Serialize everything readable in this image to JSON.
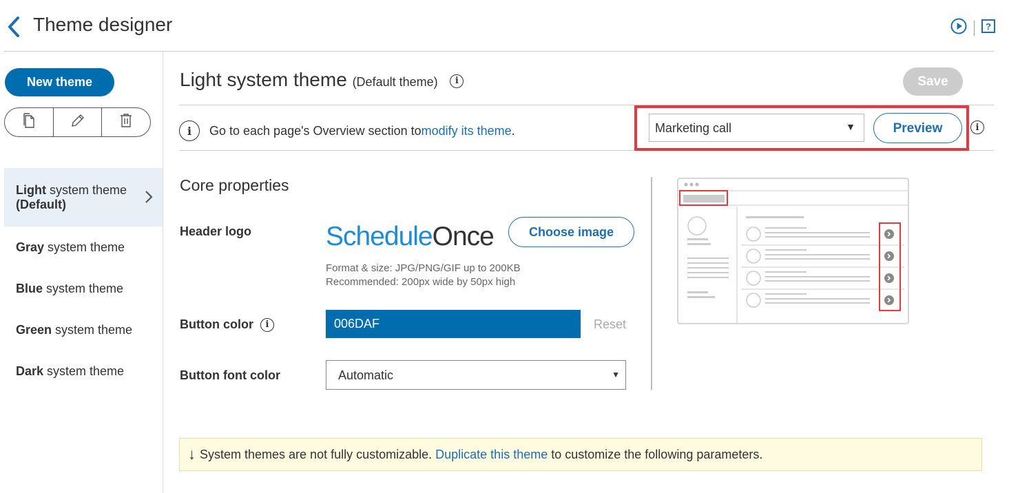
{
  "header": {
    "title": "Theme designer"
  },
  "sidebar": {
    "new_theme_label": "New theme",
    "themes": [
      {
        "bold": "Light",
        "rest": " system theme",
        "line2": "(Default)"
      },
      {
        "bold": "Gray",
        "rest": " system theme"
      },
      {
        "bold": "Blue",
        "rest": " system theme"
      },
      {
        "bold": "Green",
        "rest": " system theme"
      },
      {
        "bold": "Dark",
        "rest": " system theme"
      }
    ]
  },
  "main": {
    "title": "Light system theme",
    "subtitle": "(Default theme)",
    "save_label": "Save",
    "banner": {
      "text_before": "Go to each page's Overview section to ",
      "link": "modify its theme",
      "text_after": "."
    },
    "preview_select": "Marketing call",
    "preview_label": "Preview",
    "section_title": "Core properties",
    "header_logo_label": "Header logo",
    "logo_text_a": "Schedule",
    "logo_text_b": "Once",
    "choose_image_label": "Choose image",
    "help_line1": "Format & size: JPG/PNG/GIF up to 200KB",
    "help_line2": "Recommended: 200px wide by 50px high",
    "button_color_label": "Button color",
    "button_color_value": "006DAF",
    "reset_label": "Reset",
    "button_font_color_label": "Button font color",
    "button_font_color_value": "Automatic",
    "notice": {
      "text_before": "System themes are not fully customizable. ",
      "link": "Duplicate this theme",
      "text_after": " to customize the following parameters."
    }
  },
  "colors": {
    "accent": "#006DAF",
    "highlight": "#e5383f"
  }
}
